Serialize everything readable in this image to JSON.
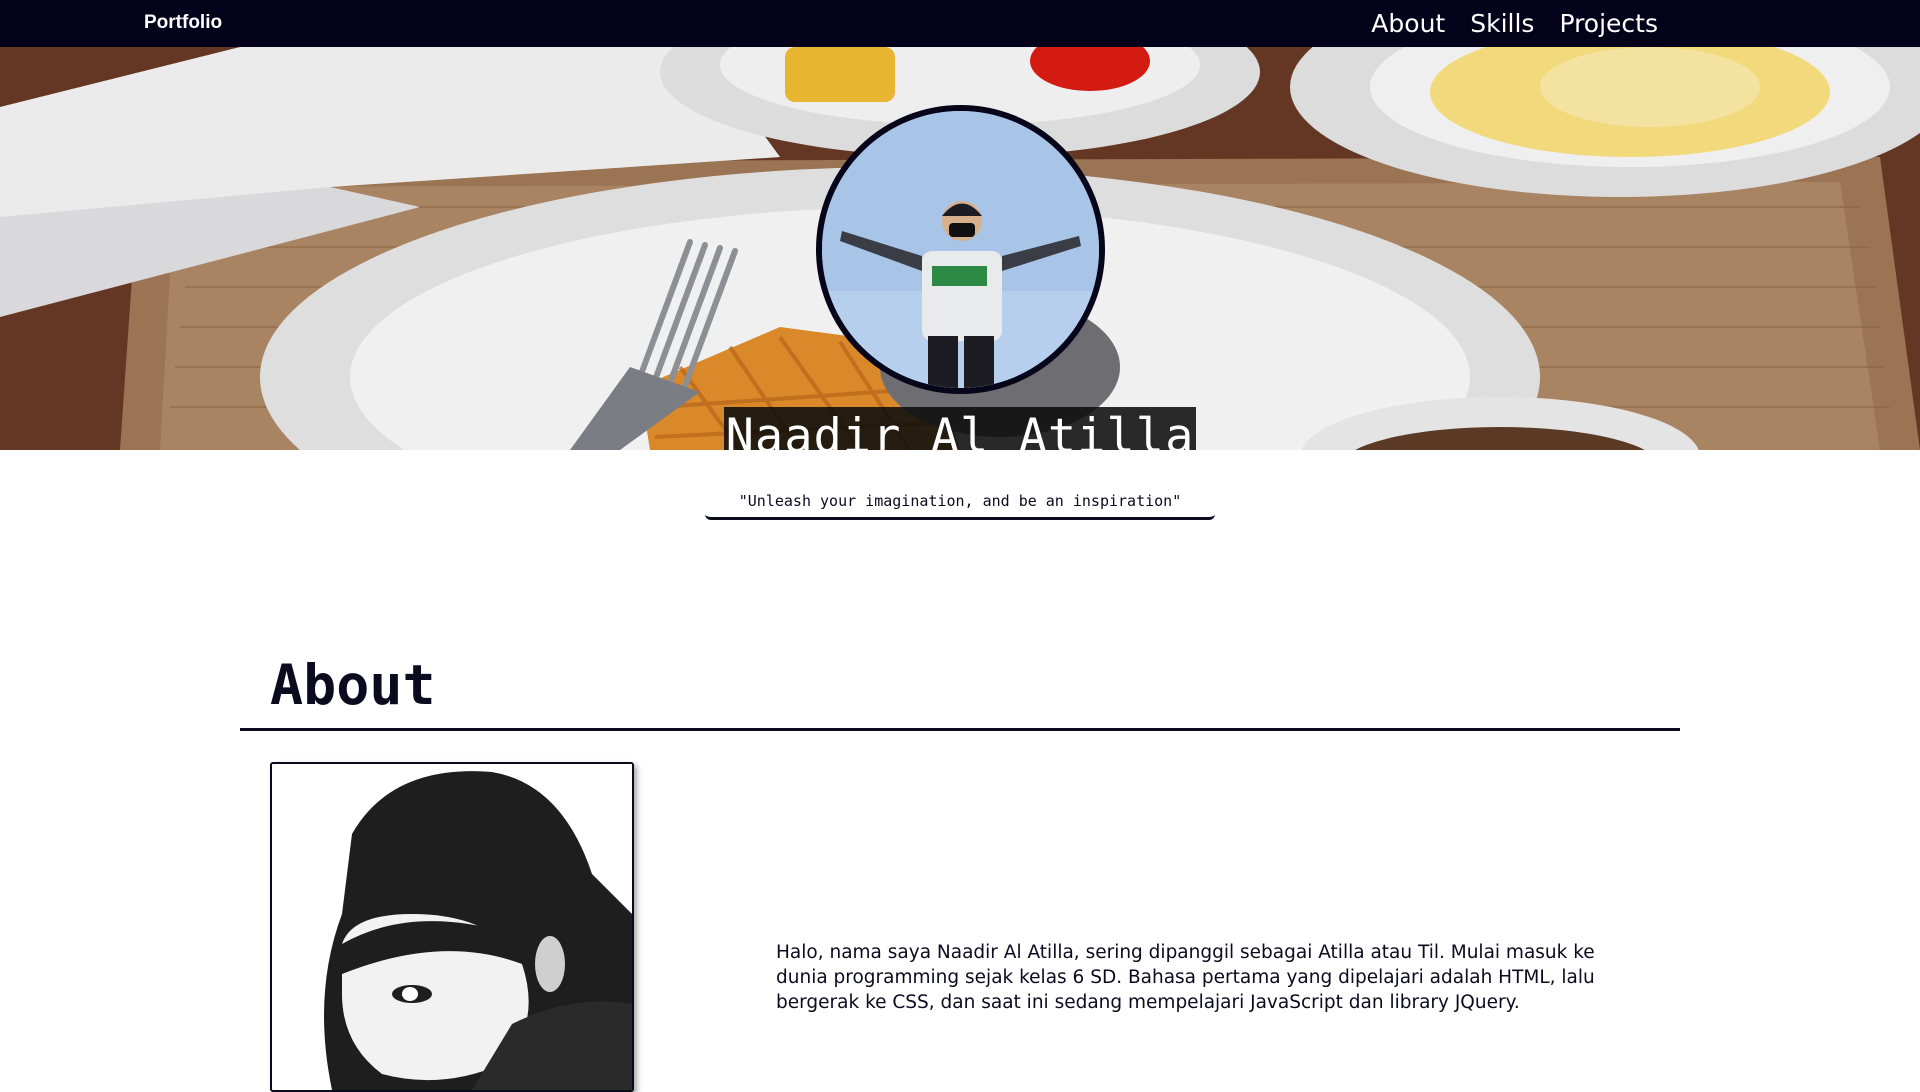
{
  "navbar": {
    "brand": "Portfolio",
    "links": [
      {
        "label": "About"
      },
      {
        "label": "Skills"
      },
      {
        "label": "Projects"
      }
    ],
    "background": "#03021a"
  },
  "hero": {
    "name": "Naadir Al Atilla",
    "quote": "\"Unleash your imagination, and be an inspiration\""
  },
  "about": {
    "title": "About",
    "paragraph": "Halo, nama saya Naadir Al Atilla, sering dipanggil sebagai Atilla atau Til. Mulai masuk ke dunia programming sejak kelas 6 SD. Bahasa pertama yang dipelajari adalah HTML, lalu bergerak ke CSS, dan saat ini sedang mempelajari JavaScript dan library JQuery."
  },
  "colors": {
    "dark": "#0b0a1f",
    "white": "#ffffff"
  }
}
